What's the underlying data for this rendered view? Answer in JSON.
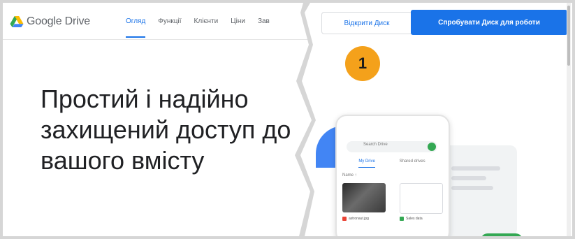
{
  "left_panel": {
    "logo": {
      "text": "Google Drive",
      "icon": "google-drive-logo-icon"
    },
    "nav": [
      "Огляд",
      "Функції",
      "Клієнти",
      "Ціни",
      "Зав"
    ],
    "headline": "Простий і надійно захищений доступ до вашого вмісту"
  },
  "right_panel": {
    "open_drive_label": "Відкрити Диск",
    "try_drive_label": "Спробувати Диск для роботи",
    "callout_number": "1",
    "illustration": {
      "search_placeholder": "Search Drive",
      "tabs": [
        "My Drive",
        "Shared drives"
      ],
      "section_label": "Name ↑",
      "files": [
        "astronaut.jpg",
        "Sales data"
      ]
    }
  },
  "colors": {
    "accent": "#1a73e8",
    "callout": "#f4a11b",
    "green": "#34a853"
  }
}
